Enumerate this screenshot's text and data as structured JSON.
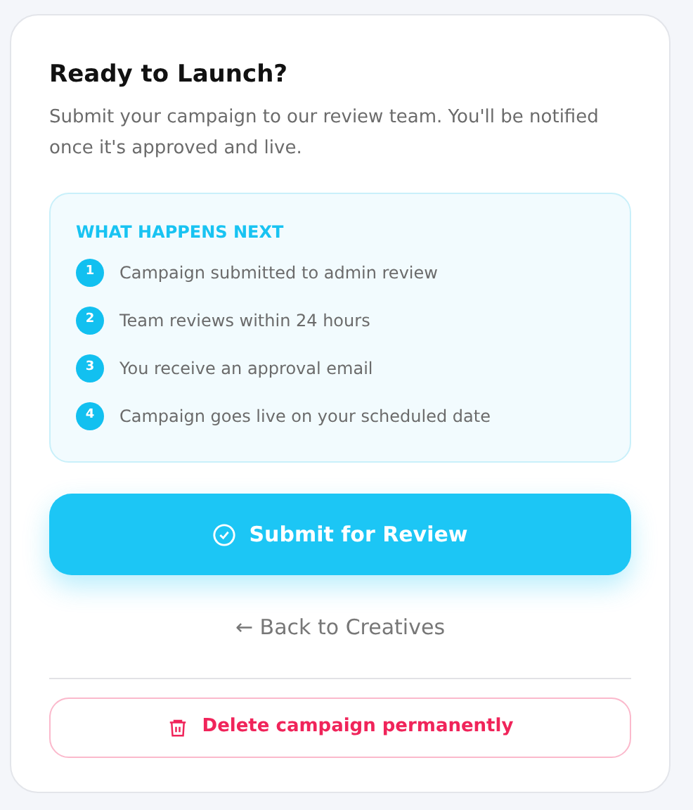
{
  "title": "Ready to Launch?",
  "description": "Submit your campaign to our review team. You'll be notified once it's approved and live.",
  "next_steps": {
    "heading": "WHAT HAPPENS NEXT",
    "steps": [
      {
        "number": "1",
        "text": "Campaign submitted to admin review"
      },
      {
        "number": "2",
        "text": "Team reviews within 24 hours"
      },
      {
        "number": "3",
        "text": "You receive an approval email"
      },
      {
        "number": "4",
        "text": "Campaign goes live on your scheduled date"
      }
    ]
  },
  "submit_button": "Submit for Review",
  "back_link": "← Back to Creatives",
  "delete_button": "Delete campaign permanently"
}
